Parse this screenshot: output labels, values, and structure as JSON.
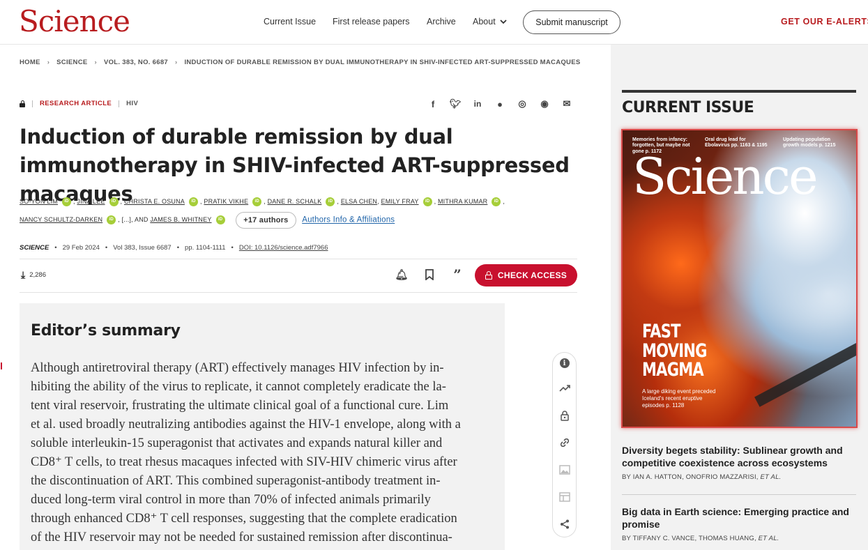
{
  "header": {
    "logo": "Science",
    "nav": [
      "Current Issue",
      "First release papers",
      "Archive",
      "About"
    ],
    "submit_label": "Submit manuscript",
    "alerts_label": "GET OUR E-ALERTS"
  },
  "breadcrumb": [
    "HOME",
    "SCIENCE",
    "VOL. 383, NO. 6687",
    "INDUCTION OF DURABLE REMISSION BY DUAL IMMUNOTHERAPY IN SHIV-INFECTED ART-SUPPRESSED MACAQUES"
  ],
  "article": {
    "type": "RESEARCH ARTICLE",
    "topic": "HIV",
    "title": "Induction of durable remission by dual immunotherapy in SHIV-infected ART-suppressed macaques",
    "authors": [
      "So-Yon Lim",
      "Jina Lee",
      "Christa E. Osuna",
      "Pratik Vikhe",
      "Dane R. Schalk",
      "Elsa Chen",
      "Emily Fray",
      "Mithra Kumar",
      "Nancy Schultz-Darken",
      "James B. Whitney"
    ],
    "authors_ellipsis": "[...], AND",
    "more_authors": "+17 authors",
    "affiliations_link": "Authors Info & Affiliations",
    "journal": "SCIENCE",
    "date": "29 Feb 2024",
    "volume": "Vol 383, Issue 6687",
    "pages": "pp. 1104-1111",
    "doi": "DOI: 10.1126/science.adf7966",
    "downloads": "2,286",
    "check_access": "CHECK ACCESS"
  },
  "summary": {
    "title": "Editor’s summary",
    "lines": [
      "Although antiretroviral therapy (ART) effectively manages HIV infection by in-",
      "hibiting the ability of the virus to replicate, it cannot completely eradicate the la-",
      "tent viral reservoir, frustrating the ultimate clinical goal of a functional cure. Lim",
      "et al. used broadly neutralizing antibodies against the HIV-1 envelope, along with a",
      "soluble interleukin-15 superagonist that activates and expands natural killer and",
      "CD8⁺ T cells, to treat rhesus macaques infected with SIV-HIV chimeric virus after",
      "the discontinuation of ART. This combined superagonist-antibody treatment in-",
      "duced long-term viral control in more than 70% of infected animals primarily",
      "through enhanced CD8⁺ T cell responses, suggesting that the complete eradication",
      "of the HIV reservoir may not be needed for sustained remission after discontinua-"
    ]
  },
  "rail": {
    "title": "CURRENT ISSUE",
    "cover": {
      "logo": "Science",
      "teasers": [
        "Memories from infancy: forgotten, but maybe not gone p. 1172",
        "Oral drug lead for Ebolavirus pp. 1163 & 1195",
        "Updating population growth models p. 1215"
      ],
      "headline": [
        "FAST",
        "MOVING",
        "MAGMA"
      ],
      "subhead": "A large diking event preceded Iceland's recent eruptive episodes p. 1128"
    },
    "articles": [
      {
        "title": "Diversity begets stability: Sublinear growth and competitive coexistence across ecosystems",
        "authors": "BY IAN A. HATTON, ONOFRIO MAZZARISI,",
        "etal": "ET AL."
      },
      {
        "title": "Big data in Earth science: Emerging practice and promise",
        "authors": "BY TIFFANY C. VANCE, THOMAS HUANG,",
        "etal": "ET AL."
      }
    ]
  },
  "colors": {
    "brand": "#b81c1f",
    "access": "#c8102e",
    "orcid": "#a6ce39"
  }
}
